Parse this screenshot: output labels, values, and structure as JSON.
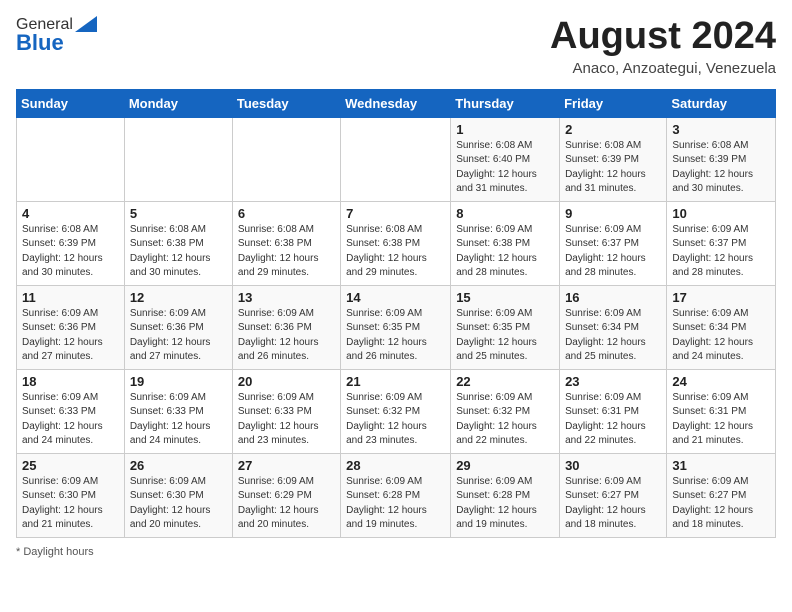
{
  "header": {
    "logo_general": "General",
    "logo_blue": "Blue",
    "title": "August 2024",
    "subtitle": "Anaco, Anzoategui, Venezuela"
  },
  "days_of_week": [
    "Sunday",
    "Monday",
    "Tuesday",
    "Wednesday",
    "Thursday",
    "Friday",
    "Saturday"
  ],
  "footer": {
    "label": "Daylight hours"
  },
  "weeks": [
    [
      {
        "day": "",
        "info": ""
      },
      {
        "day": "",
        "info": ""
      },
      {
        "day": "",
        "info": ""
      },
      {
        "day": "",
        "info": ""
      },
      {
        "day": "1",
        "info": "Sunrise: 6:08 AM\nSunset: 6:40 PM\nDaylight: 12 hours\nand 31 minutes."
      },
      {
        "day": "2",
        "info": "Sunrise: 6:08 AM\nSunset: 6:39 PM\nDaylight: 12 hours\nand 31 minutes."
      },
      {
        "day": "3",
        "info": "Sunrise: 6:08 AM\nSunset: 6:39 PM\nDaylight: 12 hours\nand 30 minutes."
      }
    ],
    [
      {
        "day": "4",
        "info": "Sunrise: 6:08 AM\nSunset: 6:39 PM\nDaylight: 12 hours\nand 30 minutes."
      },
      {
        "day": "5",
        "info": "Sunrise: 6:08 AM\nSunset: 6:38 PM\nDaylight: 12 hours\nand 30 minutes."
      },
      {
        "day": "6",
        "info": "Sunrise: 6:08 AM\nSunset: 6:38 PM\nDaylight: 12 hours\nand 29 minutes."
      },
      {
        "day": "7",
        "info": "Sunrise: 6:08 AM\nSunset: 6:38 PM\nDaylight: 12 hours\nand 29 minutes."
      },
      {
        "day": "8",
        "info": "Sunrise: 6:09 AM\nSunset: 6:38 PM\nDaylight: 12 hours\nand 28 minutes."
      },
      {
        "day": "9",
        "info": "Sunrise: 6:09 AM\nSunset: 6:37 PM\nDaylight: 12 hours\nand 28 minutes."
      },
      {
        "day": "10",
        "info": "Sunrise: 6:09 AM\nSunset: 6:37 PM\nDaylight: 12 hours\nand 28 minutes."
      }
    ],
    [
      {
        "day": "11",
        "info": "Sunrise: 6:09 AM\nSunset: 6:36 PM\nDaylight: 12 hours\nand 27 minutes."
      },
      {
        "day": "12",
        "info": "Sunrise: 6:09 AM\nSunset: 6:36 PM\nDaylight: 12 hours\nand 27 minutes."
      },
      {
        "day": "13",
        "info": "Sunrise: 6:09 AM\nSunset: 6:36 PM\nDaylight: 12 hours\nand 26 minutes."
      },
      {
        "day": "14",
        "info": "Sunrise: 6:09 AM\nSunset: 6:35 PM\nDaylight: 12 hours\nand 26 minutes."
      },
      {
        "day": "15",
        "info": "Sunrise: 6:09 AM\nSunset: 6:35 PM\nDaylight: 12 hours\nand 25 minutes."
      },
      {
        "day": "16",
        "info": "Sunrise: 6:09 AM\nSunset: 6:34 PM\nDaylight: 12 hours\nand 25 minutes."
      },
      {
        "day": "17",
        "info": "Sunrise: 6:09 AM\nSunset: 6:34 PM\nDaylight: 12 hours\nand 24 minutes."
      }
    ],
    [
      {
        "day": "18",
        "info": "Sunrise: 6:09 AM\nSunset: 6:33 PM\nDaylight: 12 hours\nand 24 minutes."
      },
      {
        "day": "19",
        "info": "Sunrise: 6:09 AM\nSunset: 6:33 PM\nDaylight: 12 hours\nand 24 minutes."
      },
      {
        "day": "20",
        "info": "Sunrise: 6:09 AM\nSunset: 6:33 PM\nDaylight: 12 hours\nand 23 minutes."
      },
      {
        "day": "21",
        "info": "Sunrise: 6:09 AM\nSunset: 6:32 PM\nDaylight: 12 hours\nand 23 minutes."
      },
      {
        "day": "22",
        "info": "Sunrise: 6:09 AM\nSunset: 6:32 PM\nDaylight: 12 hours\nand 22 minutes."
      },
      {
        "day": "23",
        "info": "Sunrise: 6:09 AM\nSunset: 6:31 PM\nDaylight: 12 hours\nand 22 minutes."
      },
      {
        "day": "24",
        "info": "Sunrise: 6:09 AM\nSunset: 6:31 PM\nDaylight: 12 hours\nand 21 minutes."
      }
    ],
    [
      {
        "day": "25",
        "info": "Sunrise: 6:09 AM\nSunset: 6:30 PM\nDaylight: 12 hours\nand 21 minutes."
      },
      {
        "day": "26",
        "info": "Sunrise: 6:09 AM\nSunset: 6:30 PM\nDaylight: 12 hours\nand 20 minutes."
      },
      {
        "day": "27",
        "info": "Sunrise: 6:09 AM\nSunset: 6:29 PM\nDaylight: 12 hours\nand 20 minutes."
      },
      {
        "day": "28",
        "info": "Sunrise: 6:09 AM\nSunset: 6:28 PM\nDaylight: 12 hours\nand 19 minutes."
      },
      {
        "day": "29",
        "info": "Sunrise: 6:09 AM\nSunset: 6:28 PM\nDaylight: 12 hours\nand 19 minutes."
      },
      {
        "day": "30",
        "info": "Sunrise: 6:09 AM\nSunset: 6:27 PM\nDaylight: 12 hours\nand 18 minutes."
      },
      {
        "day": "31",
        "info": "Sunrise: 6:09 AM\nSunset: 6:27 PM\nDaylight: 12 hours\nand 18 minutes."
      }
    ]
  ]
}
